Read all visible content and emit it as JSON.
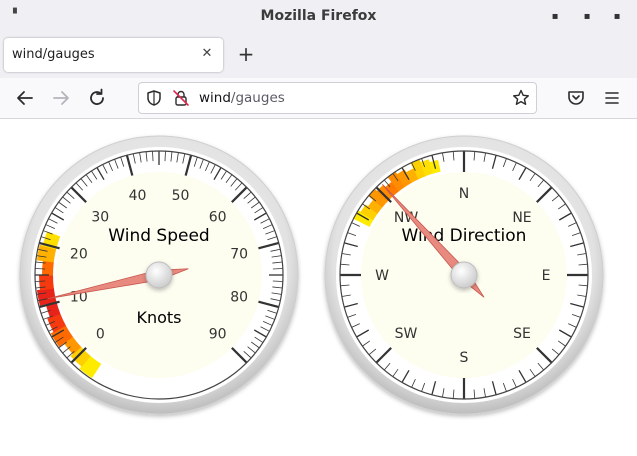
{
  "window": {
    "title": "Mozilla Firefox"
  },
  "tab": {
    "label": "wind/gauges"
  },
  "urlbar": {
    "host": "wind",
    "path": "/gauges"
  },
  "icons": {
    "back": "arrow-left-icon",
    "forward": "arrow-right-icon",
    "reload": "reload-icon",
    "shield": "shield-icon",
    "insecure": "insecure-lock-icon",
    "bookmark": "star-icon",
    "pocket": "pocket-icon",
    "menu": "hamburger-menu-icon"
  },
  "gauges": {
    "speed": {
      "title": "Wind Speed",
      "units": "Knots",
      "min": 0,
      "max": 90,
      "labels": [
        "0",
        "10",
        "20",
        "30",
        "40",
        "50",
        "60",
        "70",
        "80",
        "90"
      ],
      "value": 11,
      "highlight_color": "#e8231a"
    },
    "direction": {
      "title": "Wind Direction",
      "labels": [
        "N",
        "NE",
        "E",
        "SE",
        "S",
        "SW",
        "W",
        "NW"
      ],
      "value_degrees": 318,
      "highlight_color": "#ff8c1a"
    }
  }
}
